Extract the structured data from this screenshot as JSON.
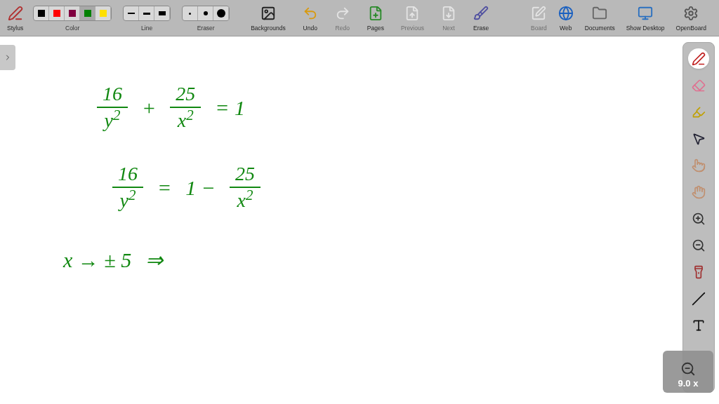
{
  "toolbar": {
    "left": [
      {
        "kind": "stylus",
        "label": "Stylus",
        "disabled": false
      }
    ],
    "colors": {
      "label": "Color",
      "swatches": [
        {
          "color": "#000000",
          "selected": false
        },
        {
          "color": "#ff0000",
          "selected": false
        },
        {
          "color": "#800040",
          "selected": false
        },
        {
          "color": "#008000",
          "selected": true
        },
        {
          "color": "#ffe000",
          "selected": false
        }
      ]
    },
    "line": {
      "label": "Line"
    },
    "eraser": {
      "label": "Eraser"
    },
    "tools": [
      {
        "kind": "backgrounds",
        "label": "Backgrounds",
        "disabled": false
      },
      {
        "kind": "undo",
        "label": "Undo",
        "disabled": false
      },
      {
        "kind": "redo",
        "label": "Redo",
        "disabled": true
      },
      {
        "kind": "pages",
        "label": "Pages",
        "disabled": false
      },
      {
        "kind": "previous",
        "label": "Previous",
        "disabled": true
      },
      {
        "kind": "next",
        "label": "Next",
        "disabled": true
      },
      {
        "kind": "erase",
        "label": "Erase",
        "disabled": false
      }
    ],
    "right": [
      {
        "kind": "board",
        "label": "Board",
        "disabled": true
      },
      {
        "kind": "web",
        "label": "Web",
        "disabled": false
      },
      {
        "kind": "documents",
        "label": "Documents",
        "disabled": false
      },
      {
        "kind": "desktop",
        "label": "Show Desktop",
        "disabled": false
      },
      {
        "kind": "openboard",
        "label": "OpenBoard",
        "disabled": false
      }
    ]
  },
  "ink": {
    "lines": [
      [
        {
          "kind": "frac",
          "num": "16",
          "den": "y$^{2}$"
        },
        {
          "kind": "text",
          "text": "+"
        },
        {
          "kind": "frac",
          "num": "25",
          "den": "x$^{2}$"
        },
        {
          "kind": "text",
          "text": "= 1"
        }
      ],
      [
        {
          "kind": "frac",
          "num": "16",
          "den": "y$^{2}$"
        },
        {
          "kind": "text",
          "text": "="
        },
        {
          "kind": "text",
          "text": "1 −"
        },
        {
          "kind": "frac",
          "num": "25",
          "den": "x$^{2}$"
        }
      ],
      [
        {
          "kind": "text",
          "text": "x → ± 5"
        },
        {
          "kind": "text",
          "text": "⇒"
        }
      ]
    ]
  },
  "dock": [
    {
      "kind": "pen",
      "selected": true
    },
    {
      "kind": "eraser",
      "selected": false
    },
    {
      "kind": "marker",
      "selected": false
    },
    {
      "kind": "selector",
      "selected": false
    },
    {
      "kind": "play",
      "selected": false
    },
    {
      "kind": "hand",
      "selected": false
    },
    {
      "kind": "zoom-in",
      "selected": false
    },
    {
      "kind": "zoom-out",
      "selected": false
    },
    {
      "kind": "laser",
      "selected": false
    },
    {
      "kind": "line",
      "selected": false
    },
    {
      "kind": "text",
      "selected": false
    }
  ],
  "zoom": {
    "reading": "9.0 x"
  }
}
